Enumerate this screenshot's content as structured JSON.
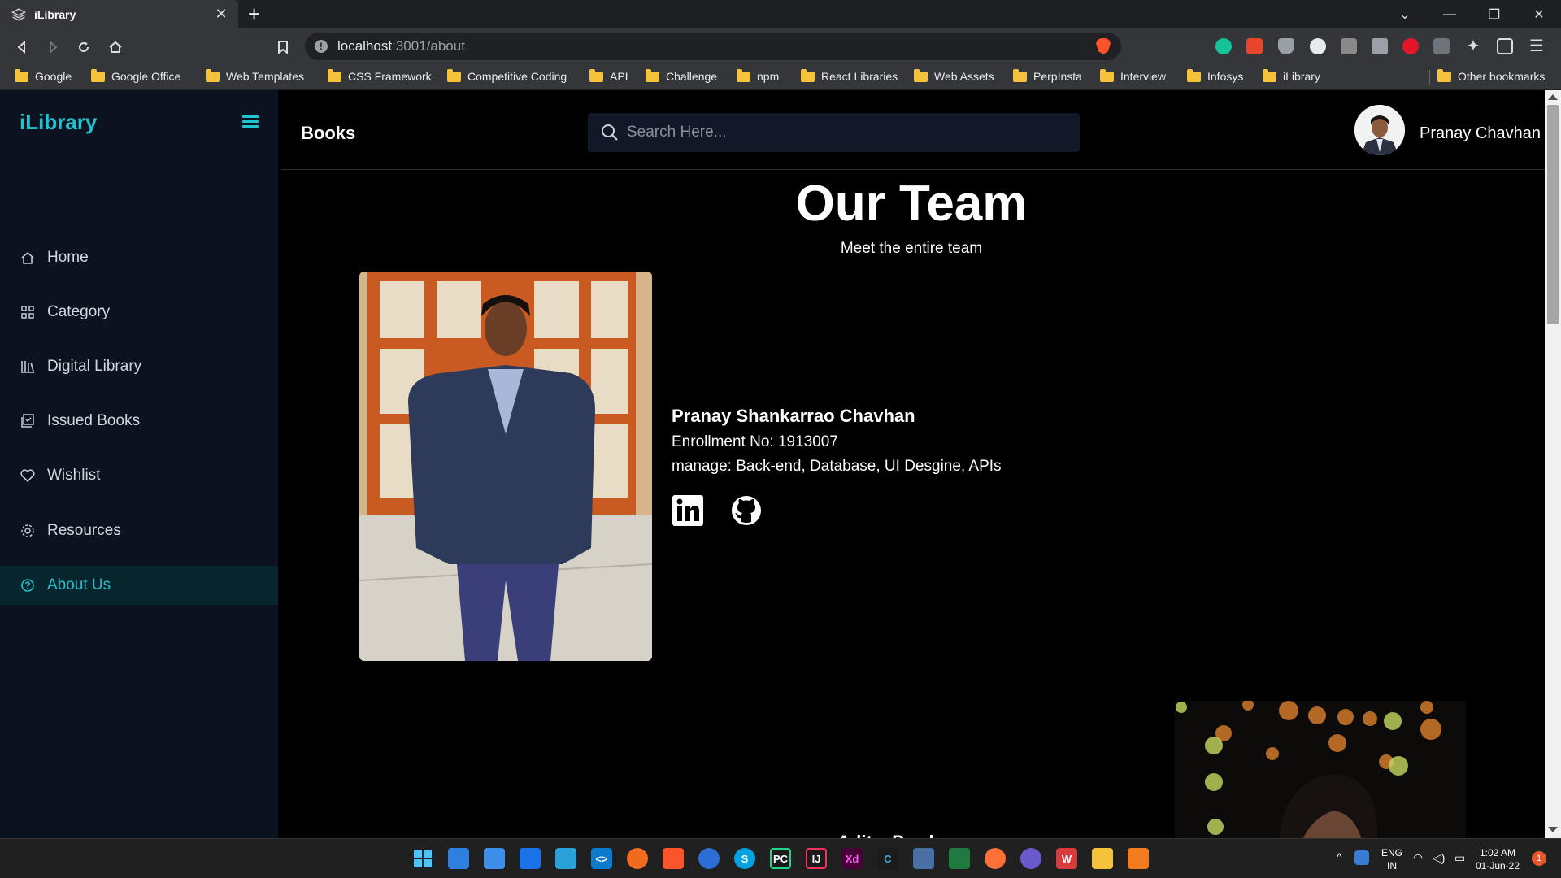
{
  "browser": {
    "tab_title": "iLibrary",
    "url_host": "localhost",
    "url_path": ":3001/about",
    "bookmarks": [
      "Google",
      "Google Office",
      "Web Templates",
      "CSS Framework",
      "Competitive Coding",
      "API",
      "Challenge",
      "npm",
      "React Libraries",
      "Web Assets",
      "PerpInsta",
      "Interview",
      "Infosys",
      "iLibrary"
    ],
    "other_bookmarks": "Other bookmarks"
  },
  "sidebar": {
    "brand": "iLibrary",
    "items": [
      {
        "label": "Home",
        "icon": "home-icon"
      },
      {
        "label": "Category",
        "icon": "grid-icon"
      },
      {
        "label": "Digital Library",
        "icon": "library-icon"
      },
      {
        "label": "Issued Books",
        "icon": "issued-books-icon"
      },
      {
        "label": "Wishlist",
        "icon": "heart-icon"
      },
      {
        "label": "Resources",
        "icon": "gear-icon"
      },
      {
        "label": "About Us",
        "icon": "help-circle-icon",
        "active": true
      }
    ]
  },
  "header": {
    "title": "Books",
    "search_placeholder": "Search Here...",
    "user_name": "Pranay Chavhan"
  },
  "team": {
    "heading": "Our Team",
    "subheading": "Meet the entire team",
    "members": [
      {
        "name": "Pranay Shankarrao Chavhan",
        "enrollment": "Enrollment No: 1913007",
        "manage": "manage: Back-end, Database, UI Desgine, APIs",
        "socials": [
          "linkedin-icon",
          "github-icon"
        ]
      },
      {
        "name": "Adit... Powle..."
      }
    ]
  },
  "taskbar": {
    "lang_top": "ENG",
    "lang_bottom": "IN",
    "time": "1:02 AM",
    "date": "01-Jun-22",
    "notification_count": "1"
  },
  "colors": {
    "accent": "#20c3d0",
    "sidebar_bg": "#0b1320",
    "active_bg": "#07252c",
    "page_bg": "#000000"
  }
}
